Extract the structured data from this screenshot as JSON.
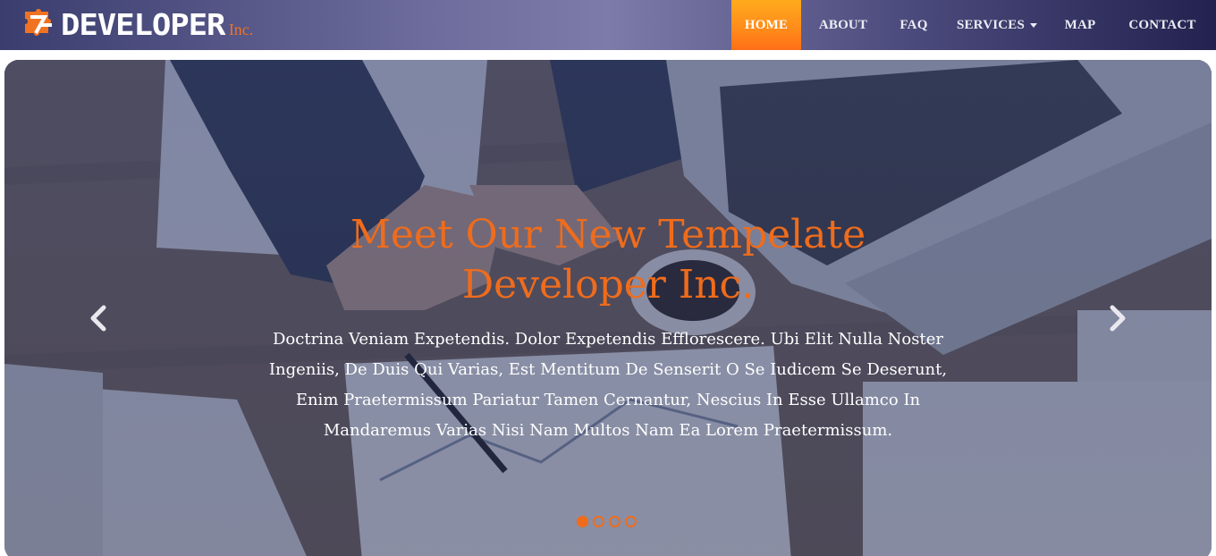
{
  "brand": {
    "name": "DEVELOPER",
    "suffix": "Inc.",
    "logo_icon": "puzzle-icon",
    "accent_color": "#ef6c1c"
  },
  "nav": {
    "items": [
      {
        "label": "HOME",
        "active": true
      },
      {
        "label": "ABOUT"
      },
      {
        "label": "FAQ"
      },
      {
        "label": "SERVICES"
      },
      {
        "label": "MAP"
      },
      {
        "label": "CONTACT"
      }
    ],
    "services_icon": "caret-down-icon"
  },
  "hero": {
    "title_line1": "Meet Our New Tempelate",
    "title_line2": "Developer Inc.",
    "text": "Doctrina Veniam Expetendis. Dolor Expetendis Efflorescere. Ubi Elit Nulla Noster Ingeniis, De Duis Qui Varias, Est Mentitum De Senserit O Se Iudicem Se Deserunt, Enim Praetermissum Pariatur Tamen Cernantur, Nescius In Esse Ullamco In Mandaremus Varias Nisi Nam Multos Nam Ea Lorem Praetermissum.",
    "prev_icon": "chevron-left-icon",
    "next_icon": "chevron-right-icon",
    "slide_count": 4,
    "active_slide": 1
  }
}
